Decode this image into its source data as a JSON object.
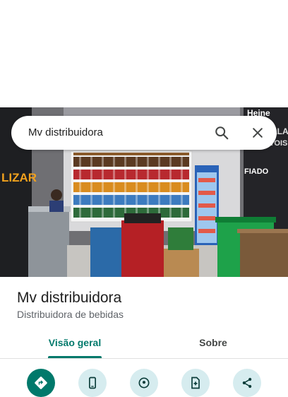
{
  "search": {
    "query": "Mv distribuidora"
  },
  "place": {
    "name": "Mv distribuidora",
    "category": "Distribuidora de bebidas"
  },
  "tabs": [
    {
      "label": "Visão geral",
      "active": true
    },
    {
      "label": "Sobre",
      "active": false
    }
  ],
  "photo": {
    "wall_texts": [
      "LIZAR",
      "Heine",
      "STELLA",
      "ARTOIS",
      "FIADO"
    ]
  },
  "actions": [
    {
      "icon": "directions-icon"
    },
    {
      "icon": "phone-icon"
    },
    {
      "icon": "location-icon"
    },
    {
      "icon": "save-icon"
    },
    {
      "icon": "share-icon"
    }
  ],
  "colors": {
    "accent": "#00796b",
    "action_bg": "#d6ecef",
    "text_primary": "#1f1f1f",
    "text_secondary": "#5f6368"
  }
}
